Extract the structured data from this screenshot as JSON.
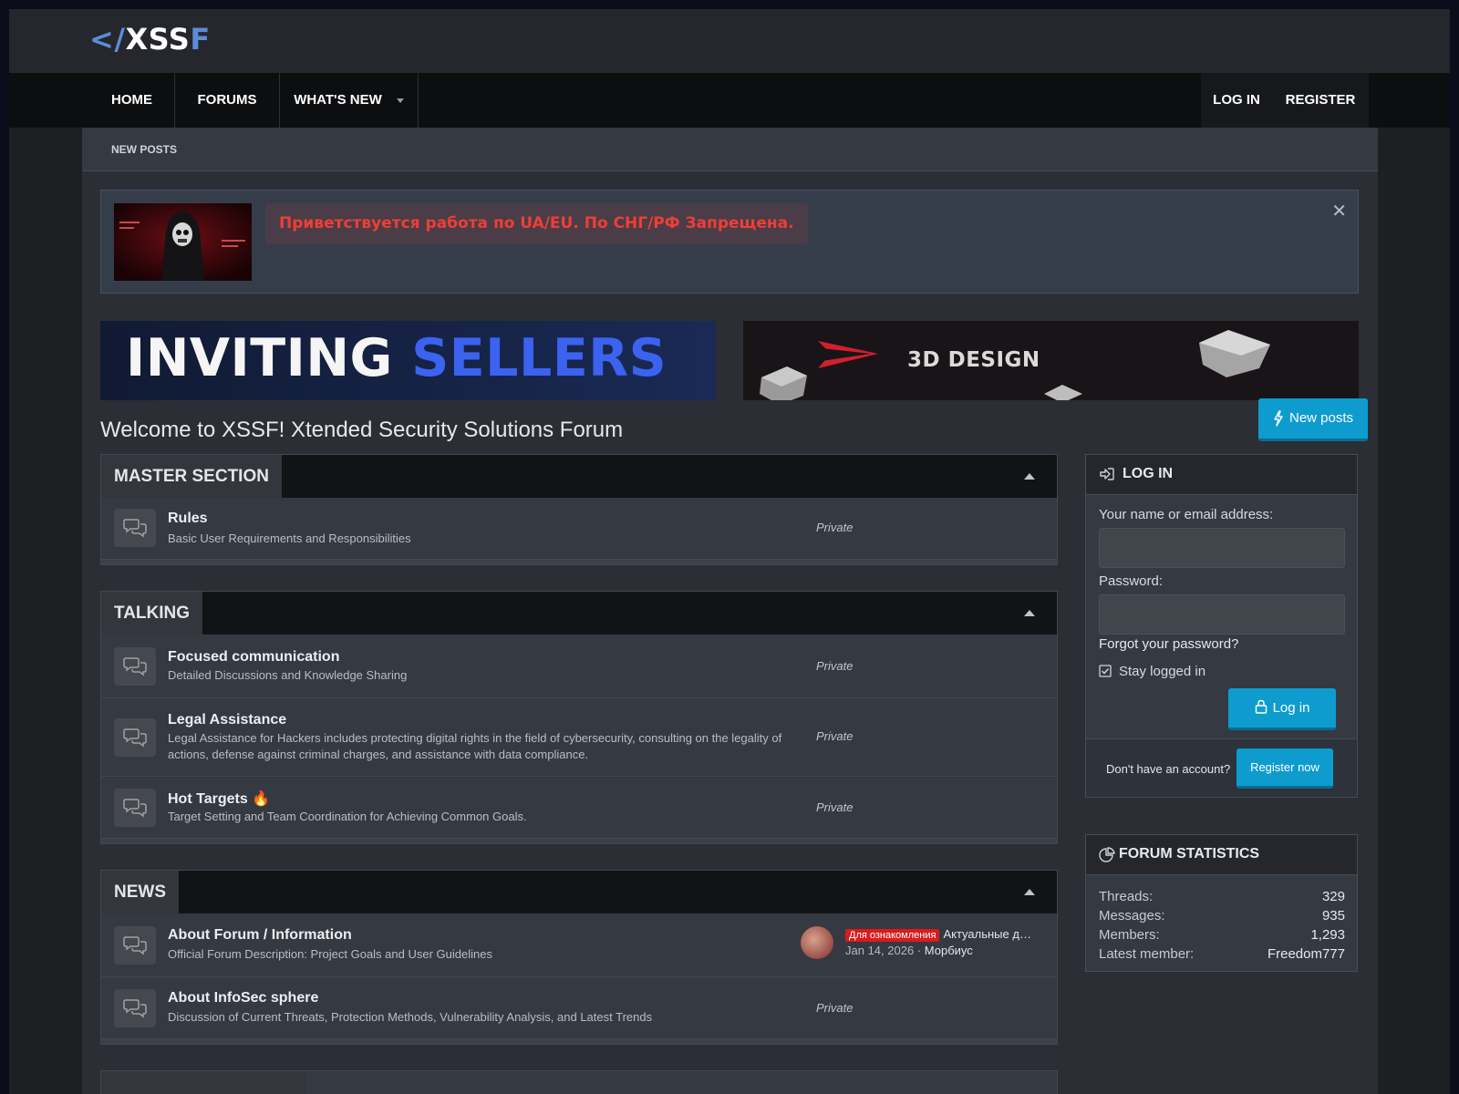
{
  "header": {
    "logo_prefix": "</",
    "logo_main": "XSS",
    "logo_suffix": "F"
  },
  "nav": {
    "items": [
      {
        "label": "HOME"
      },
      {
        "label": "FORUMS"
      },
      {
        "label": "WHAT'S NEW"
      }
    ],
    "login_label": "LOG IN",
    "register_label": "REGISTER"
  },
  "subnav": {
    "label": "NEW POSTS"
  },
  "notice": {
    "text": "Приветствуется работа по UA/EU. По СНГ/РФ Запрещена."
  },
  "banners": {
    "left_white": "INVITING",
    "left_blue": "SELLERS",
    "right": "3D DESIGN"
  },
  "welcome": "Welcome to XSSF! Xtended Security Solutions Forum",
  "new_posts_button": "New posts",
  "sections": [
    {
      "title": "MASTER SECTION",
      "nodes": [
        {
          "title": "Rules",
          "desc": "Basic User Requirements and Responsibilities",
          "status": "Private"
        }
      ]
    },
    {
      "title": "TALKING",
      "nodes": [
        {
          "title": "Focused communication",
          "desc": "Detailed Discussions and Knowledge Sharing",
          "status": "Private"
        },
        {
          "title": "Legal Assistance",
          "desc": "Legal Assistance for Hackers includes protecting digital rights in the field of cybersecurity, consulting on the legality of actions, defense against criminal charges, and assistance with data compliance.",
          "status": "Private"
        },
        {
          "title": "Hot Targets",
          "title_emoji": "🔥",
          "desc": "Target Setting and Team Coordination for Achieving Common Goals.",
          "status": "Private"
        }
      ]
    },
    {
      "title": "NEWS",
      "nodes": [
        {
          "title": "About Forum / Information",
          "desc": "Official Forum Description: Project Goals and User Guidelines",
          "latest": {
            "tag": "Для ознакомления",
            "thread": "Актуальные д…",
            "date": "Jan 14, 2026",
            "separator": "·",
            "user": "Морбиус"
          }
        },
        {
          "title": "About InfoSec sphere",
          "desc": "Discussion of Current Threats, Protection Methods, Vulnerability Analysis, and Latest Trends",
          "status": "Private"
        }
      ]
    }
  ],
  "login": {
    "title": "LOG IN",
    "name_label": "Your name or email address:",
    "password_label": "Password:",
    "forgot": "Forgot your password?",
    "stay": "Stay logged in",
    "stay_checked": true,
    "button": "Log in",
    "no_account": "Don't have an account?",
    "register": "Register now"
  },
  "stats": {
    "title": "FORUM STATISTICS",
    "rows": [
      {
        "label": "Threads:",
        "value": "329"
      },
      {
        "label": "Messages:",
        "value": "935"
      },
      {
        "label": "Members:",
        "value": "1,293"
      },
      {
        "label": "Latest member:",
        "value": "Freedom777"
      }
    ]
  },
  "colors": {
    "accent": "#0e9ccf",
    "brand_blue": "#5d8bd8",
    "notice_red": "#ef3e36"
  },
  "icons": {
    "node": "comments-icon",
    "close": "close-icon",
    "new_posts": "bolt-icon",
    "login": "sign-in-icon",
    "lock": "lock-icon",
    "stats": "pie-chart-icon",
    "collapse": "caret-up-icon",
    "dropdown": "caret-down-icon",
    "checkbox": "checkbox-checked-icon"
  }
}
